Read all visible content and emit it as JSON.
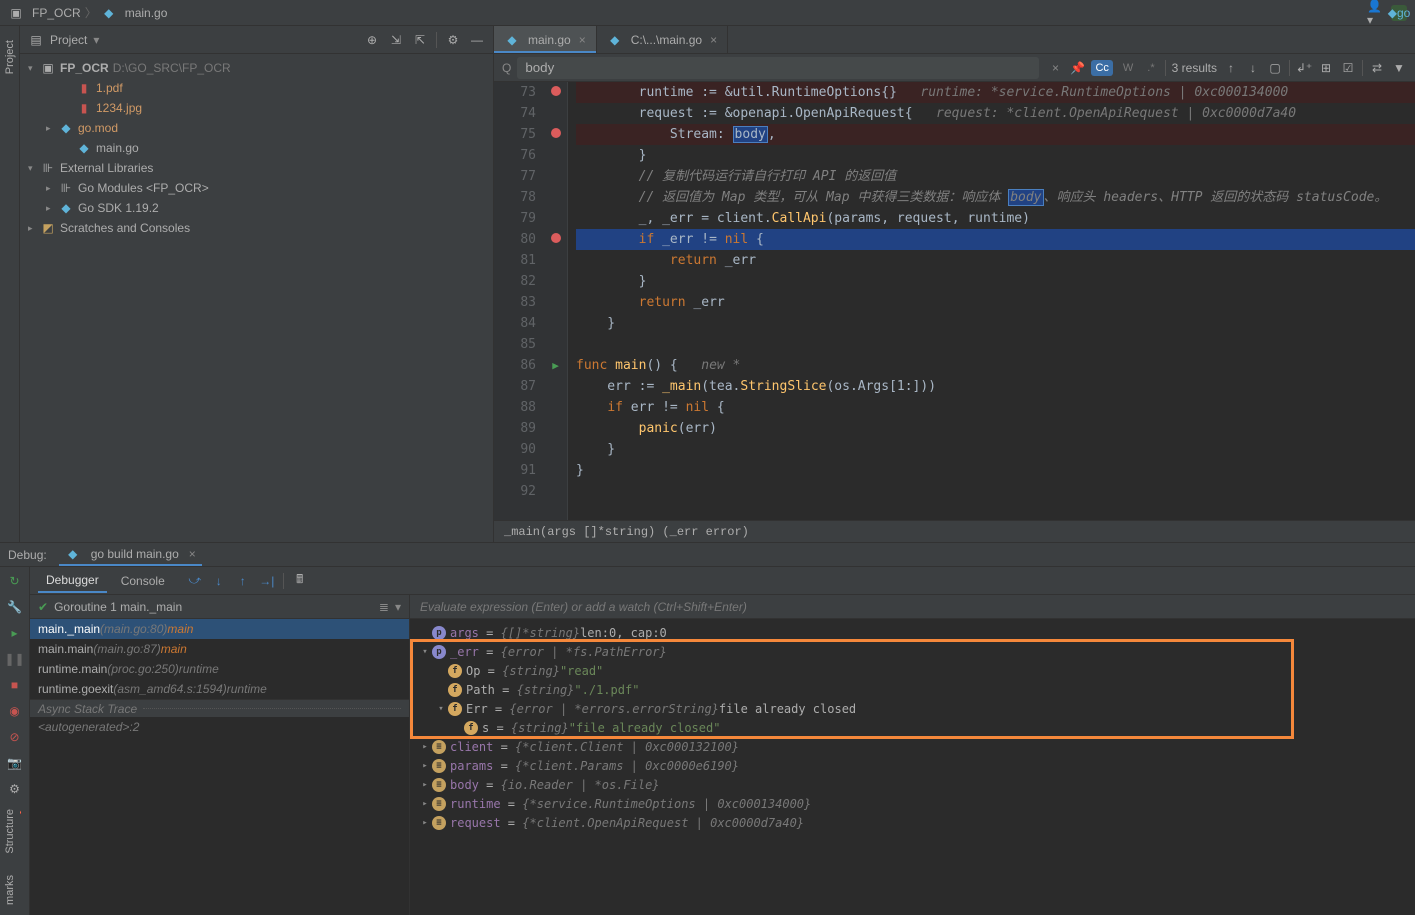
{
  "breadcrumb": {
    "root": "FP_OCR",
    "file": "main.go"
  },
  "top_right": {
    "user_icon": "user",
    "run_label": "go"
  },
  "project_panel": {
    "title": "Project",
    "root": {
      "name": "FP_OCR",
      "path": "D:\\GO_SRC\\FP_OCR"
    },
    "files": [
      {
        "name": "1.pdf",
        "type": "pdf"
      },
      {
        "name": "1234.jpg",
        "type": "image"
      },
      {
        "name": "go.mod",
        "type": "go",
        "modified": true
      },
      {
        "name": "main.go",
        "type": "go"
      }
    ],
    "external": {
      "label": "External Libraries",
      "children": [
        {
          "name": "Go Modules <FP_OCR>"
        },
        {
          "name": "Go SDK 1.19.2"
        }
      ]
    },
    "scratches": "Scratches and Consoles"
  },
  "editor": {
    "tabs": [
      {
        "label": "main.go",
        "active": true
      },
      {
        "label": "C:\\...\\main.go",
        "active": false
      }
    ],
    "search": {
      "query": "body",
      "results": "3 results",
      "case_sensitive": "Cc",
      "words": "W",
      "regex": ".*"
    },
    "status_fn": "_main(args []*string) (_err error)",
    "lines": [
      {
        "n": 73,
        "bp": true,
        "text": "        runtime := &util.RuntimeOptions{}",
        "hint": "runtime: *service.RuntimeOptions | 0xc000134000"
      },
      {
        "n": 74,
        "text": "        request := &openapi.OpenApiRequest{",
        "hint": "request: *client.OpenApiRequest | 0xc0000d7a40"
      },
      {
        "n": 75,
        "bp": true,
        "text": "            Stream: body,",
        "body": true
      },
      {
        "n": 76,
        "text": "        }"
      },
      {
        "n": 77,
        "text": "        // 复制代码运行请自行打印 API 的返回值"
      },
      {
        "n": 78,
        "text": "        // 返回值为 Map 类型，可从 Map 中获得三类数据：响应体 body、响应头 headers、HTTP 返回的状态码 statusCode。",
        "body": true
      },
      {
        "n": 79,
        "text": "        _, _err = client.CallApi(params, request, runtime)"
      },
      {
        "n": 80,
        "bp": true,
        "cur": true,
        "text": "        if _err != nil {"
      },
      {
        "n": 81,
        "text": "            return _err"
      },
      {
        "n": 82,
        "text": "        }"
      },
      {
        "n": 83,
        "text": "        return _err"
      },
      {
        "n": 84,
        "text": "    }"
      },
      {
        "n": 85,
        "text": ""
      },
      {
        "n": 86,
        "run": true,
        "text": "func main() {",
        "hint": "new *"
      },
      {
        "n": 87,
        "text": "    err := _main(tea.StringSlice(os.Args[1:]))"
      },
      {
        "n": 88,
        "text": "    if err != nil {"
      },
      {
        "n": 89,
        "text": "        panic(err)"
      },
      {
        "n": 90,
        "text": "    }"
      },
      {
        "n": 91,
        "text": "}"
      },
      {
        "n": 92,
        "text": ""
      }
    ]
  },
  "debug": {
    "title": "Debug:",
    "config": "go build main.go",
    "tabs": {
      "debugger": "Debugger",
      "console": "Console"
    },
    "goroutine": "Goroutine 1 main._main",
    "frames": [
      {
        "fn": "main._main",
        "loc": "(main.go:80)",
        "scope": "main",
        "active": true
      },
      {
        "fn": "main.main",
        "loc": "(main.go:87)",
        "scope": "main"
      },
      {
        "fn": "runtime.main",
        "loc": "(proc.go:250)",
        "scope": "runtime"
      },
      {
        "fn": "runtime.goexit",
        "loc": "(asm_amd64.s:1594)",
        "scope": "runtime"
      }
    ],
    "async_trace": "Async Stack Trace",
    "async_entry": "<autogenerated>:2",
    "eval_placeholder": "Evaluate expression (Enter) or add a watch (Ctrl+Shift+Enter)",
    "vars": {
      "args": {
        "type": "{[]*string}",
        "val": "len:0, cap:0"
      },
      "_err": {
        "type": "{error | *fs.PathError}",
        "Op": {
          "type": "{string}",
          "val": "\"read\""
        },
        "Path": {
          "type": "{string}",
          "val": "\"./1.pdf\""
        },
        "Err": {
          "type": "{error | *errors.errorString}",
          "val": "file already closed",
          "s": {
            "type": "{string}",
            "val": "\"file already closed\""
          }
        }
      },
      "client": {
        "type": "{*client.Client | 0xc000132100}"
      },
      "params": {
        "type": "{*client.Params | 0xc0000e6190}"
      },
      "body": {
        "type": "{io.Reader | *os.File}"
      },
      "runtime": {
        "type": "{*service.RuntimeOptions | 0xc000134000}"
      },
      "request": {
        "type": "{*client.OpenApiRequest | 0xc0000d7a40}"
      }
    }
  },
  "sidebar_labels": {
    "project": "Project",
    "structure": "Structure",
    "bookmarks": "marks"
  }
}
